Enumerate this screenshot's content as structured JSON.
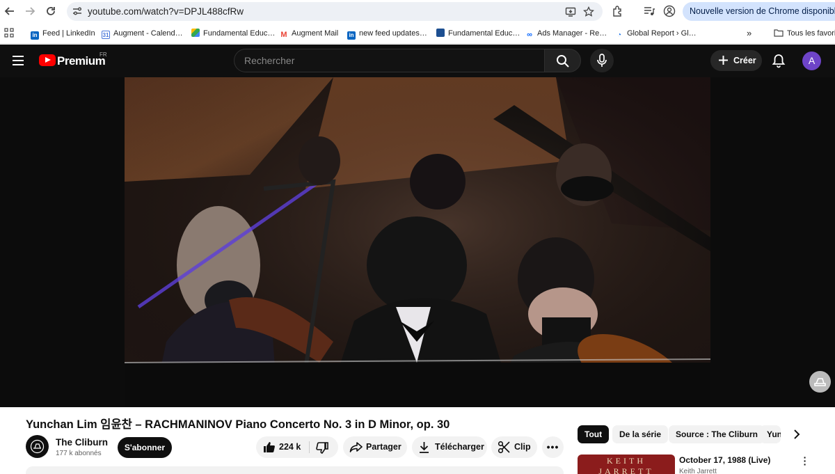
{
  "browser": {
    "url": "youtube.com/watch?v=DPJL488cfRw",
    "update_label": "Nouvelle version de Chrome disponible",
    "bookmarks": [
      {
        "label": "Feed | LinkedIn"
      },
      {
        "label": "Augment - Calend…"
      },
      {
        "label": "Fundamental Educ…"
      },
      {
        "label": "Augment Mail"
      },
      {
        "label": "new feed updates…"
      },
      {
        "label": "Fundamental Educ…"
      },
      {
        "label": "Ads Manager - Re…"
      },
      {
        "label": "Global Report › Gl…"
      }
    ],
    "all_bookmarks_label": "Tous les favoris"
  },
  "masthead": {
    "logo_text": "Premium",
    "region": "FR",
    "search_placeholder": "Rechercher",
    "create_label": "Créer",
    "avatar_letter": "A"
  },
  "video": {
    "title": "Yunchan Lim 임윤찬 – RACHMANINOV Piano Concerto No. 3 in D Minor, op. 30",
    "channel": "The Cliburn",
    "subscribers": "177 k abonnés",
    "subscribe_label": "S'abonner",
    "like_count": "224 k",
    "share_label": "Partager",
    "download_label": "Télécharger",
    "clip_label": "Clip"
  },
  "sidebar": {
    "chips": [
      "Tout",
      "De la série",
      "Source : The Cliburn",
      "Yun"
    ],
    "recommendation": {
      "title": "October 17, 1988 (Live)",
      "channel": "Keith Jarrett",
      "thumb_text": "KEITH JARRETT"
    }
  },
  "colors": {
    "yt_red": "#ff0000",
    "masthead_bg": "#0f0f0f",
    "avatar": "#6e44c8",
    "chrome_update_pill": "#d3e3fd"
  }
}
